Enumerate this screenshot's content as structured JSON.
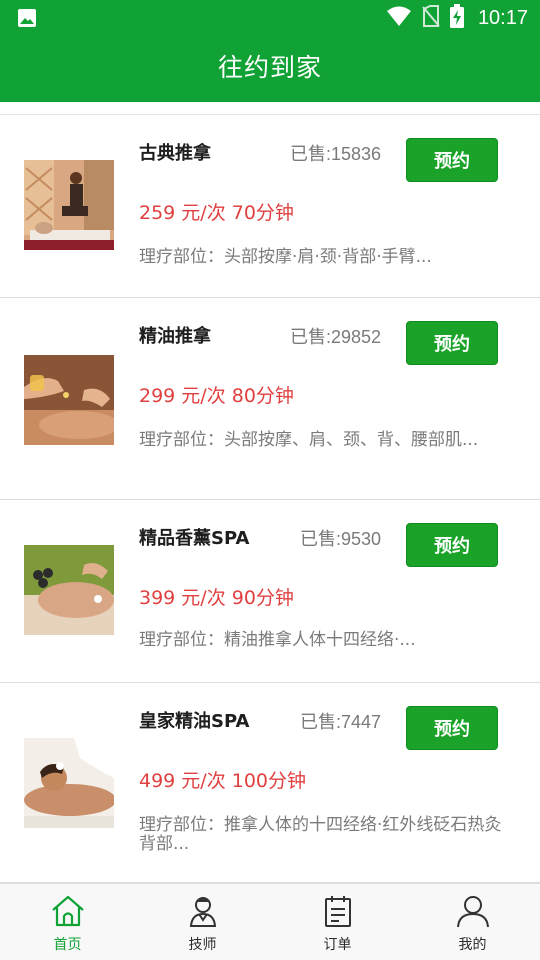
{
  "status_bar": {
    "time": "10:17"
  },
  "header": {
    "title": "往约到家"
  },
  "book_label": "预约",
  "services": [
    {
      "name": "古典推拿",
      "sold": "已售:15836",
      "price": "259 元/次 70分钟",
      "desc": "理疗部位：头部按摩·肩·颈·背部·手臂..."
    },
    {
      "name": "精油推拿",
      "sold": "已售:29852",
      "price": "299 元/次 80分钟",
      "desc": "理疗部位：头部按摩、肩、颈、背、腰部肌..."
    },
    {
      "name": "精品香薰SPA",
      "sold": "已售:9530",
      "price": "399 元/次 90分钟",
      "desc": "理疗部位：精油推拿人体十四经络·..."
    },
    {
      "name": "皇家精油SPA",
      "sold": "已售:7447",
      "price": "499 元/次 100分钟",
      "desc": "理疗部位：推拿人体的十四经络·红外线砭石热灸背部..."
    }
  ],
  "tabs": [
    {
      "label": "首页",
      "icon": "home-icon",
      "active": true
    },
    {
      "label": "技师",
      "icon": "technician-icon",
      "active": false
    },
    {
      "label": "订单",
      "icon": "order-icon",
      "active": false
    },
    {
      "label": "我的",
      "icon": "profile-icon",
      "active": false
    }
  ],
  "colors": {
    "brand": "#11a235",
    "price": "#e04040",
    "button": "#1aa328"
  }
}
